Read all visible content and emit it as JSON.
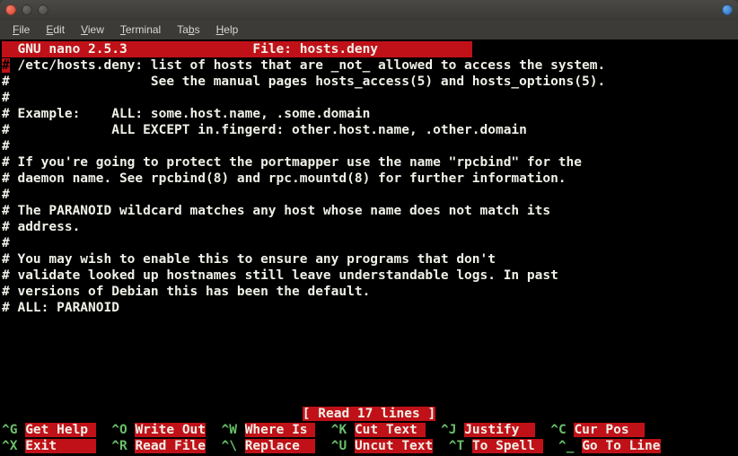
{
  "menubar": {
    "file": "File",
    "edit": "Edit",
    "view": "View",
    "terminal": "Terminal",
    "tabs": "Tabs",
    "help": "Help"
  },
  "nano": {
    "version": "  GNU nano 2.5.3            ",
    "file_label": "    File: hosts.deny            ",
    "status": "[ Read 17 lines ]",
    "content_lines": [
      "# /etc/hosts.deny: list of hosts that are _not_ allowed to access the system.",
      "#                  See the manual pages hosts_access(5) and hosts_options(5).",
      "#",
      "# Example:    ALL: some.host.name, .some.domain",
      "#             ALL EXCEPT in.fingerd: other.host.name, .other.domain",
      "#",
      "# If you're going to protect the portmapper use the name \"rpcbind\" for the",
      "# daemon name. See rpcbind(8) and rpc.mountd(8) for further information.",
      "#",
      "# The PARANOID wildcard matches any host whose name does not match its",
      "# address.",
      "#",
      "# You may wish to enable this to ensure any programs that don't",
      "# validate looked up hostnames still leave understandable logs. In past",
      "# versions of Debian this has been the default.",
      "# ALL: PARANOID"
    ],
    "shortcuts": {
      "row1": [
        {
          "key": "^G",
          "label": "Get Help "
        },
        {
          "key": "^O",
          "label": "Write Out"
        },
        {
          "key": "^W",
          "label": "Where Is "
        },
        {
          "key": "^K",
          "label": "Cut Text "
        },
        {
          "key": "^J",
          "label": "Justify  "
        },
        {
          "key": "^C",
          "label": "Cur Pos  "
        }
      ],
      "row2": [
        {
          "key": "^X",
          "label": "Exit     "
        },
        {
          "key": "^R",
          "label": "Read File"
        },
        {
          "key": "^\\",
          "label": "Replace  "
        },
        {
          "key": "^U",
          "label": "Uncut Text"
        },
        {
          "key": "^T",
          "label": "To Spell "
        },
        {
          "key": "^_",
          "label": "Go To Line"
        }
      ]
    }
  }
}
